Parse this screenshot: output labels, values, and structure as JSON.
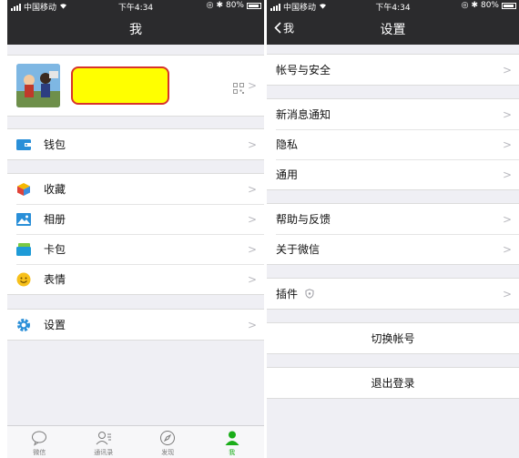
{
  "status": {
    "carrier": "中国移动",
    "time": "下午4:34",
    "battery": "80%"
  },
  "left": {
    "nav_title": "我",
    "menu": {
      "wallet": "钱包",
      "favorites": "收藏",
      "album": "相册",
      "cards": "卡包",
      "stickers": "表情",
      "settings": "设置"
    },
    "tabs": [
      "微信",
      "通讯录",
      "发现",
      "我"
    ]
  },
  "right": {
    "nav_back": "我",
    "nav_title": "设置",
    "items": {
      "account_security": "帐号与安全",
      "notifications": "新消息通知",
      "privacy": "隐私",
      "general": "通用",
      "help_feedback": "帮助与反馈",
      "about": "关于微信",
      "plugins": "插件",
      "switch_account": "切换帐号",
      "logout": "退出登录"
    }
  },
  "colors": {
    "nav_bg": "#2b2b2d",
    "page_bg": "#efeff4",
    "accent_green": "#1aad19",
    "highlight_fill": "#ffff00",
    "highlight_border": "#d8342a"
  }
}
